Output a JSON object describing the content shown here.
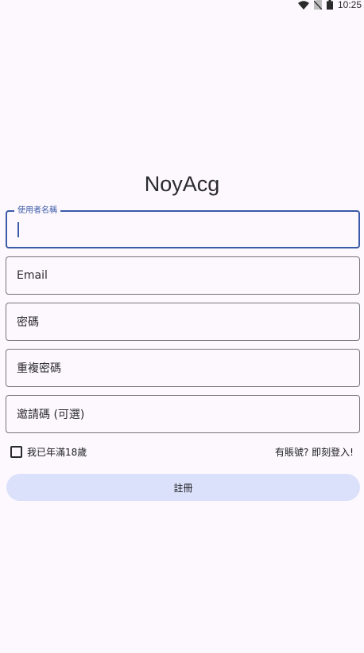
{
  "status_bar": {
    "time": "10:25",
    "icons": [
      "wifi-icon",
      "no-sim-icon",
      "battery-icon"
    ]
  },
  "app": {
    "title": "NoyAcg"
  },
  "form": {
    "username": {
      "label": "使用者名稱",
      "value": ""
    },
    "email": {
      "placeholder": "Email"
    },
    "password": {
      "placeholder": "密碼"
    },
    "confirm_password": {
      "placeholder": "重複密碼"
    },
    "invite_code": {
      "placeholder": "邀請碼 (可選)"
    },
    "age_check": {
      "label": "我已年滿18歲",
      "checked": false
    },
    "login_prompt": "有賬號? 即刻登入!",
    "register_label": "註冊"
  },
  "colors": {
    "background": "#fcf8fd",
    "accent": "#3b5aa8",
    "button_bg": "#dce1fb",
    "outline": "#76757c"
  }
}
